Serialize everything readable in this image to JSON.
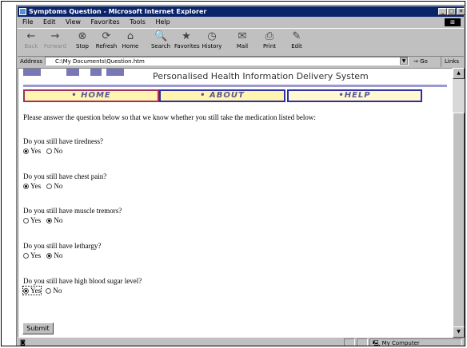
{
  "window": {
    "title": "Symptoms Question - Microsoft Internet Explorer"
  },
  "titlebar_buttons": {
    "minimize": "_",
    "maximize": "□",
    "close": "✕"
  },
  "menu": [
    "File",
    "Edit",
    "View",
    "Favorites",
    "Tools",
    "Help"
  ],
  "toolbar": [
    {
      "label": "Back",
      "icon": "←",
      "disabled": true
    },
    {
      "label": "Forward",
      "icon": "→",
      "disabled": true
    },
    {
      "label": "Stop",
      "icon": "⊗",
      "disabled": false
    },
    {
      "label": "Refresh",
      "icon": "⟳",
      "disabled": false
    },
    {
      "label": "Home",
      "icon": "⌂",
      "disabled": false
    },
    {
      "label": "Search",
      "icon": "🔍",
      "disabled": false
    },
    {
      "label": "Favorites",
      "icon": "★",
      "disabled": false
    },
    {
      "label": "History",
      "icon": "◷",
      "disabled": false
    },
    {
      "label": "Mail",
      "icon": "✉",
      "disabled": false
    },
    {
      "label": "Print",
      "icon": "⎙",
      "disabled": false
    },
    {
      "label": "Edit",
      "icon": "✎",
      "disabled": false
    }
  ],
  "address": {
    "label": "Address",
    "value": "C:\\My Documents\\Question.htm",
    "go_label": "Go",
    "links_label": "Links"
  },
  "page": {
    "system_name": "Personalised Health Information Delivery System",
    "nav": [
      {
        "label": "• HOME",
        "border_color": "#a03060",
        "fill": "#fff4b0"
      },
      {
        "label": "• ABOUT",
        "border_color": "#3030a0",
        "fill": "#fff4b0"
      },
      {
        "label": "•HELP",
        "border_color": "#3030a0",
        "fill": "#fff8d0"
      }
    ],
    "intro": "Please answer the question below so that we know whether you still take the medication listed below:",
    "questions": [
      {
        "text": "Do you still have tiredness?",
        "answer": "Yes"
      },
      {
        "text": "Do you still have chest pain?",
        "answer": "Yes"
      },
      {
        "text": "Do you still have muscle tremors?",
        "answer": "No"
      },
      {
        "text": "Do you still have lethargy?",
        "answer": "No"
      },
      {
        "text": "Do you still have high blood sugar level?",
        "answer": "Yes"
      }
    ],
    "option_yes": "Yes",
    "option_no": "No",
    "submit_label": "Submit"
  },
  "status": {
    "zone": "My Computer"
  }
}
